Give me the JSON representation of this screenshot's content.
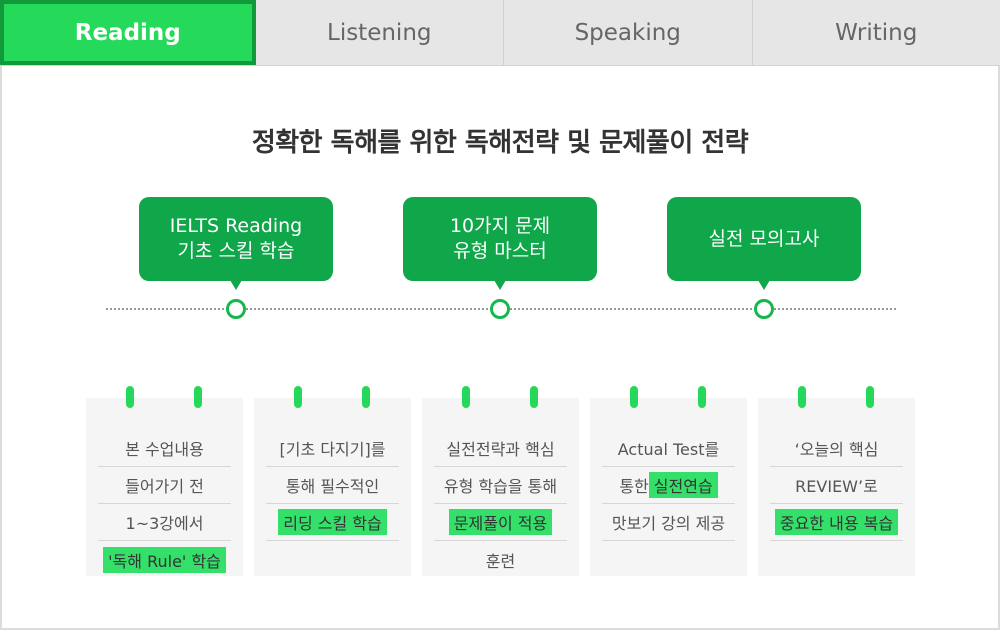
{
  "tabs": [
    {
      "label": "Reading",
      "active": true
    },
    {
      "label": "Listening",
      "active": false
    },
    {
      "label": "Speaking",
      "active": false
    },
    {
      "label": "Writing",
      "active": false
    }
  ],
  "title": "정확한 독해를 위한 독해전략 및 문제풀이 전략",
  "steps": [
    {
      "line1": "IELTS Reading",
      "line2": "기초 스킬 학습"
    },
    {
      "line1": "10가지 문제",
      "line2": "유형 마스터"
    },
    {
      "line1": "실전 모의고사",
      "line2": ""
    }
  ],
  "cards": [
    {
      "lines": [
        {
          "text": "본 수업내용",
          "highlight": false
        },
        {
          "text": "들어가기 전",
          "highlight": false
        },
        {
          "text": "1~3강에서",
          "highlight": false
        },
        {
          "text": "'독해 Rule' 학습",
          "highlight": true
        }
      ]
    },
    {
      "lines": [
        {
          "text": "[기초 다지기]를",
          "highlight": false
        },
        {
          "text": "통해 필수적인",
          "highlight": false
        },
        {
          "text": "리딩 스킬 학습",
          "highlight": true
        }
      ]
    },
    {
      "lines": [
        {
          "text": "실전전략과 핵심",
          "highlight": false
        },
        {
          "text": "유형 학습을 통해",
          "highlight": false
        },
        {
          "text": "문제풀이 적용",
          "highlight": true
        },
        {
          "text": "훈련",
          "highlight": false
        }
      ]
    },
    {
      "lines": [
        {
          "text": "Actual Test를",
          "highlight": false
        },
        {
          "pre": "통한 ",
          "text": "실전연습",
          "highlight": true
        },
        {
          "text": "맛보기 강의 제공",
          "highlight": false
        }
      ]
    },
    {
      "lines": [
        {
          "text": "‘오늘의 핵심",
          "highlight": false
        },
        {
          "text": "REVIEW’로",
          "highlight": false
        },
        {
          "text": "중요한 내용 복습",
          "highlight": true
        }
      ]
    }
  ],
  "colors": {
    "active_tab": "#25da5a",
    "bubble": "#0fa74a",
    "highlight": "#34e06a",
    "pin": "#25d85a"
  }
}
